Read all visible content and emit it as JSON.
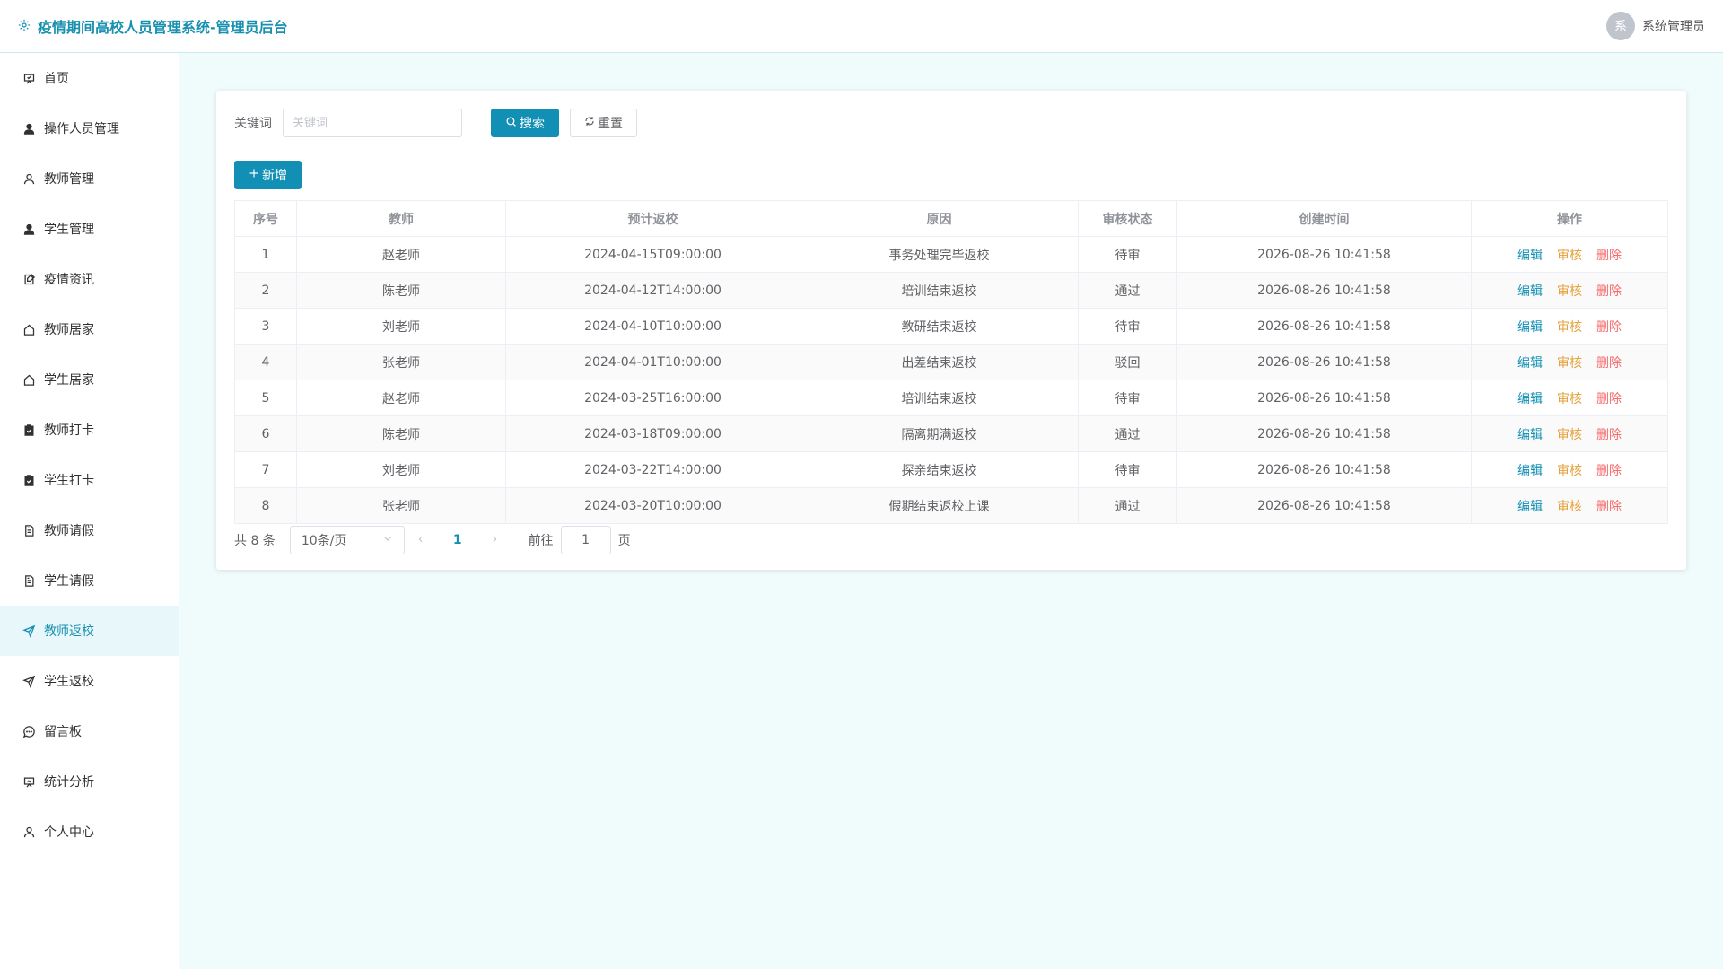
{
  "header": {
    "title": "疫情期间高校人员管理系统-管理员后台",
    "avatar_text": "系",
    "user_name": "系统管理员"
  },
  "sidebar": {
    "items": [
      {
        "label": "首页",
        "icon": "home-icon"
      },
      {
        "label": "操作人员管理",
        "icon": "user-icon"
      },
      {
        "label": "教师管理",
        "icon": "user-outline-icon"
      },
      {
        "label": "学生管理",
        "icon": "user-icon"
      },
      {
        "label": "疫情资讯",
        "icon": "news-icon"
      },
      {
        "label": "教师居家",
        "icon": "house-icon"
      },
      {
        "label": "学生居家",
        "icon": "house-icon"
      },
      {
        "label": "教师打卡",
        "icon": "checkin-icon"
      },
      {
        "label": "学生打卡",
        "icon": "checkin-icon"
      },
      {
        "label": "教师请假",
        "icon": "document-icon"
      },
      {
        "label": "学生请假",
        "icon": "document-icon"
      },
      {
        "label": "教师返校",
        "icon": "send-icon",
        "active": true
      },
      {
        "label": "学生返校",
        "icon": "send-icon"
      },
      {
        "label": "留言板",
        "icon": "chat-icon"
      },
      {
        "label": "统计分析",
        "icon": "chart-icon"
      },
      {
        "label": "个人中心",
        "icon": "user-outline-icon"
      }
    ]
  },
  "filter": {
    "keyword_label": "关键词",
    "keyword_placeholder": "关键词",
    "keyword_value": "",
    "search_label": "搜索",
    "reset_label": "重置"
  },
  "toolbar": {
    "add_label": "新增"
  },
  "table": {
    "columns": [
      "序号",
      "教师",
      "预计返校",
      "原因",
      "审核状态",
      "创建时间",
      "操作"
    ],
    "actions": {
      "edit": "编辑",
      "audit": "审核",
      "delete": "删除"
    },
    "rows": [
      {
        "no": "1",
        "teacher": "赵老师",
        "expected": "2024-04-15T09:00:00",
        "reason": "事务处理完毕返校",
        "status": "待审",
        "created": "2026-08-26 10:41:58"
      },
      {
        "no": "2",
        "teacher": "陈老师",
        "expected": "2024-04-12T14:00:00",
        "reason": "培训结束返校",
        "status": "通过",
        "created": "2026-08-26 10:41:58"
      },
      {
        "no": "3",
        "teacher": "刘老师",
        "expected": "2024-04-10T10:00:00",
        "reason": "教研结束返校",
        "status": "待审",
        "created": "2026-08-26 10:41:58"
      },
      {
        "no": "4",
        "teacher": "张老师",
        "expected": "2024-04-01T10:00:00",
        "reason": "出差结束返校",
        "status": "驳回",
        "created": "2026-08-26 10:41:58"
      },
      {
        "no": "5",
        "teacher": "赵老师",
        "expected": "2024-03-25T16:00:00",
        "reason": "培训结束返校",
        "status": "待审",
        "created": "2026-08-26 10:41:58"
      },
      {
        "no": "6",
        "teacher": "陈老师",
        "expected": "2024-03-18T09:00:00",
        "reason": "隔离期满返校",
        "status": "通过",
        "created": "2026-08-26 10:41:58"
      },
      {
        "no": "7",
        "teacher": "刘老师",
        "expected": "2024-03-22T14:00:00",
        "reason": "探亲结束返校",
        "status": "待审",
        "created": "2026-08-26 10:41:58"
      },
      {
        "no": "8",
        "teacher": "张老师",
        "expected": "2024-03-20T10:00:00",
        "reason": "假期结束返校上课",
        "status": "通过",
        "created": "2026-08-26 10:41:58"
      }
    ]
  },
  "pagination": {
    "total_text": "共 8 条",
    "page_size": "10条/页",
    "current_page": "1",
    "goto_label": "前往",
    "goto_value": "1",
    "goto_suffix": "页"
  },
  "colors": {
    "primary": "#128fb4",
    "audit": "#e6a23c",
    "danger": "#f56c6c",
    "page_bg": "#f0fbfb"
  }
}
